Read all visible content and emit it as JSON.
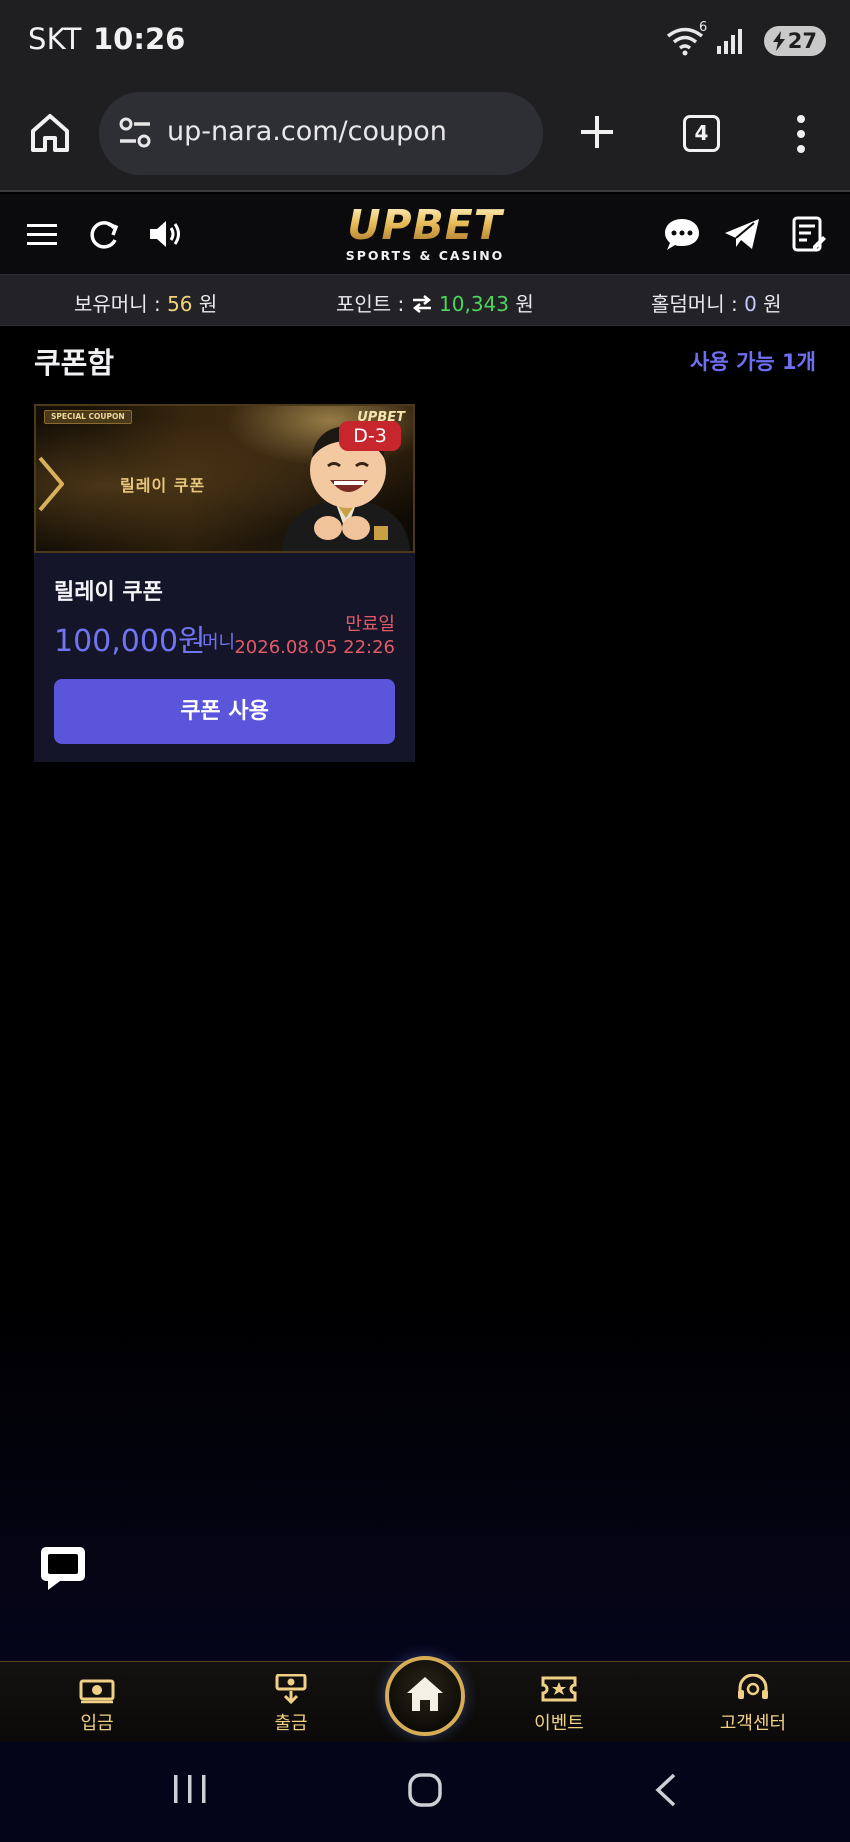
{
  "status_bar": {
    "carrier": "SKT",
    "time": "10:26",
    "battery": "27",
    "wifi_badge": "6"
  },
  "browser": {
    "url": "up-nara.com/coupon",
    "tab_count": "4"
  },
  "logo": {
    "main": "UPBET",
    "sub": "SPORTS & CASINO"
  },
  "balances": {
    "money_label": "보유머니 : ",
    "money_value": "56",
    "money_unit": " 원",
    "point_label": "포인트 : ",
    "point_value": "10,343",
    "point_unit": " 원",
    "holdem_label": "홀덤머니 : ",
    "holdem_value": "0",
    "holdem_unit": " 원"
  },
  "coupon_box": {
    "title": "쿠폰함",
    "available": "사용 가능 1개",
    "coupons": [
      {
        "tag": "SPECIAL COUPON",
        "banner_title": "릴레이 쿠폰",
        "banner_logo": "UPBET",
        "dday": "D-3",
        "name": "릴레이 쿠폰",
        "amount": "100,000원",
        "unit": "머니",
        "expire_label": "만료일",
        "expire_date": "2026.08.05 22:26",
        "use_label": "쿠폰 사용"
      }
    ]
  },
  "bottom_nav": {
    "deposit": "입금",
    "withdraw": "출금",
    "event": "이벤트",
    "support": "고객센터"
  },
  "colors": {
    "accent": "#5a55db",
    "gold": "#d6ad55",
    "point_green": "#4ed45c",
    "expire_red": "#e25a66",
    "dday_red": "#c7262d"
  }
}
